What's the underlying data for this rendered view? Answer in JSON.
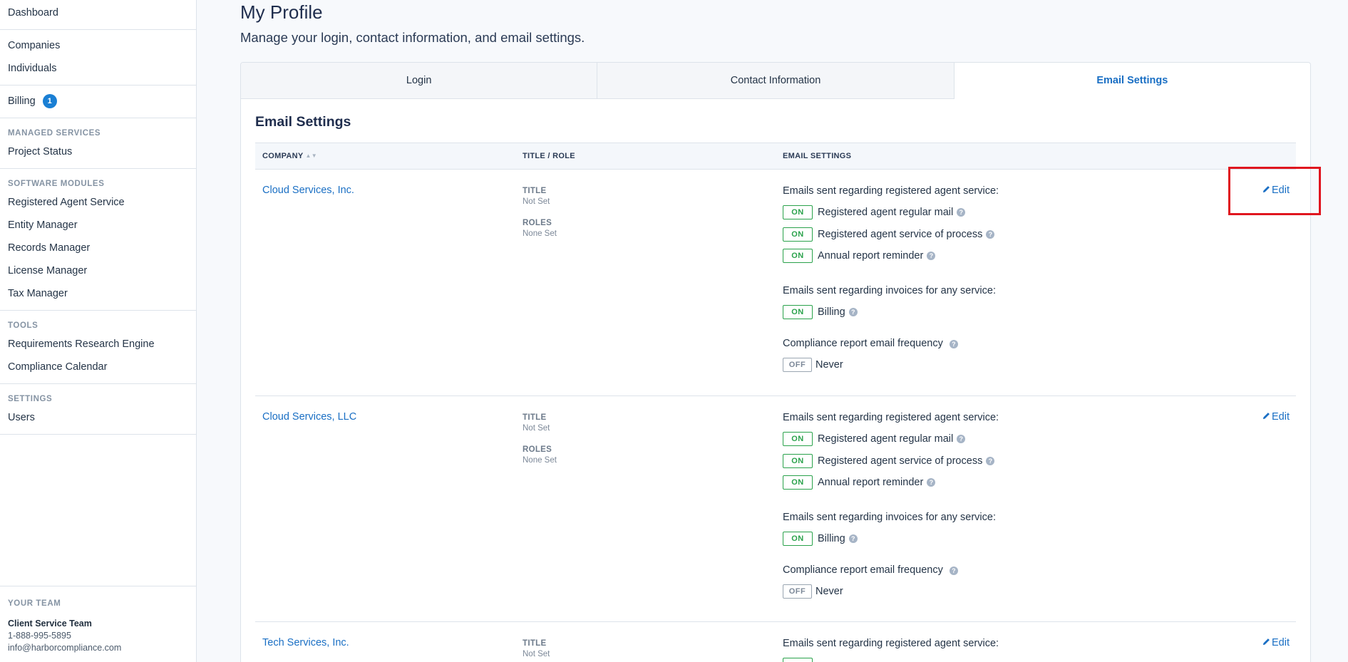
{
  "sidebar": {
    "items": {
      "dashboard": "Dashboard",
      "companies": "Companies",
      "individuals": "Individuals",
      "billing": "Billing",
      "billing_badge": "1",
      "project_status": "Project Status",
      "registered_agent": "Registered Agent Service",
      "entity_manager": "Entity Manager",
      "records_manager": "Records Manager",
      "license_manager": "License Manager",
      "tax_manager": "Tax Manager",
      "requirements": "Requirements Research Engine",
      "compliance_calendar": "Compliance Calendar",
      "users": "Users"
    },
    "headings": {
      "managed": "MANAGED SERVICES",
      "software": "SOFTWARE MODULES",
      "tools": "TOOLS",
      "settings": "SETTINGS"
    },
    "team": {
      "heading": "YOUR TEAM",
      "name": "Client Service Team",
      "phone": "1-888-995-5895",
      "email": "info@harborcompliance.com"
    }
  },
  "page": {
    "title": "My Profile",
    "subtitle": "Manage your login, contact information, and email settings."
  },
  "tabs": {
    "login": "Login",
    "contact": "Contact Information",
    "email": "Email Settings"
  },
  "section_title": "Email Settings",
  "table": {
    "headers": {
      "company": "COMPANY",
      "title_role": "TITLE / ROLE",
      "email_settings": "EMAIL SETTINGS"
    },
    "labels": {
      "title": "TITLE",
      "roles": "ROLES",
      "group_agent": "Emails sent regarding registered agent service:",
      "group_invoices": "Emails sent regarding invoices for any service:",
      "group_compliance": "Compliance report email frequency",
      "regular_mail": "Registered agent regular mail",
      "service_of_process": "Registered agent service of process",
      "annual_report": "Annual report reminder",
      "billing": "Billing",
      "never": "Never",
      "on": "ON",
      "off": "OFF",
      "edit": "Edit"
    },
    "rows": [
      {
        "company": "Cloud Services, Inc.",
        "title": "Not Set",
        "roles": "None Set"
      },
      {
        "company": "Cloud Services, LLC",
        "title": "Not Set",
        "roles": "None Set"
      },
      {
        "company": "Tech Services, Inc.",
        "title": "Not Set"
      }
    ]
  },
  "colors": {
    "accent": "#1a6fc4",
    "on": "#2aa24b",
    "highlight": "#e0161f"
  }
}
